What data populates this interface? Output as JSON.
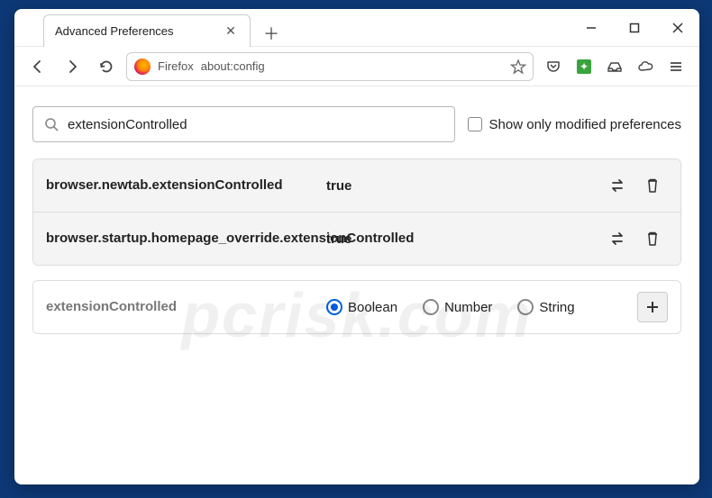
{
  "tab": {
    "title": "Advanced Preferences"
  },
  "address": {
    "brand": "Firefox",
    "url": "about:config"
  },
  "search": {
    "value": "extensionControlled"
  },
  "showModified": {
    "label": "Show only modified preferences",
    "checked": false
  },
  "prefs": [
    {
      "name": "browser.newtab.extensionControlled",
      "value": "true"
    },
    {
      "name": "browser.startup.homepage_override.extensionControlled",
      "value": "true"
    }
  ],
  "newPref": {
    "name": "extensionControlled",
    "types": [
      "Boolean",
      "Number",
      "String"
    ],
    "selected": "Boolean"
  }
}
